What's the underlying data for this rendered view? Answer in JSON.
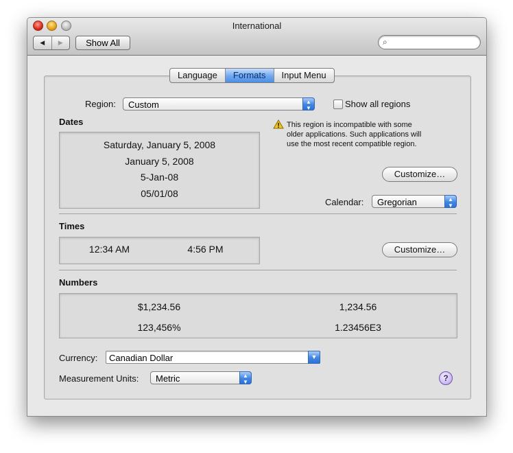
{
  "window": {
    "title": "International"
  },
  "toolbar": {
    "back_label": "◀",
    "forward_label": "▶",
    "show_all_label": "Show All",
    "search_value": "",
    "search_placeholder": ""
  },
  "tabs": [
    {
      "label": "Language",
      "active": false
    },
    {
      "label": "Formats",
      "active": true
    },
    {
      "label": "Input Menu",
      "active": false
    }
  ],
  "region": {
    "label": "Region:",
    "value": "Custom",
    "show_all_label": "Show all regions",
    "show_all_checked": false
  },
  "warning": {
    "lines": [
      "This region is incompatible with some",
      "older applications. Such applications will",
      "use the most recent compatible region."
    ]
  },
  "dates": {
    "heading": "Dates",
    "examples": [
      "Saturday, January 5, 2008",
      "January 5, 2008",
      "5-Jan-08",
      "05/01/08"
    ],
    "customize_label": "Customize…",
    "calendar_label": "Calendar:",
    "calendar_value": "Gregorian"
  },
  "times": {
    "heading": "Times",
    "examples": [
      "12:34 AM",
      "4:56 PM"
    ],
    "customize_label": "Customize…"
  },
  "numbers": {
    "heading": "Numbers",
    "examples": [
      "$1,234.56",
      "1,234.56",
      "123,456%",
      "1.23456E3"
    ]
  },
  "currency": {
    "label": "Currency:",
    "value": "Canadian Dollar"
  },
  "measurement": {
    "label": "Measurement Units:",
    "value": "Metric"
  },
  "help": {
    "label": "?"
  }
}
